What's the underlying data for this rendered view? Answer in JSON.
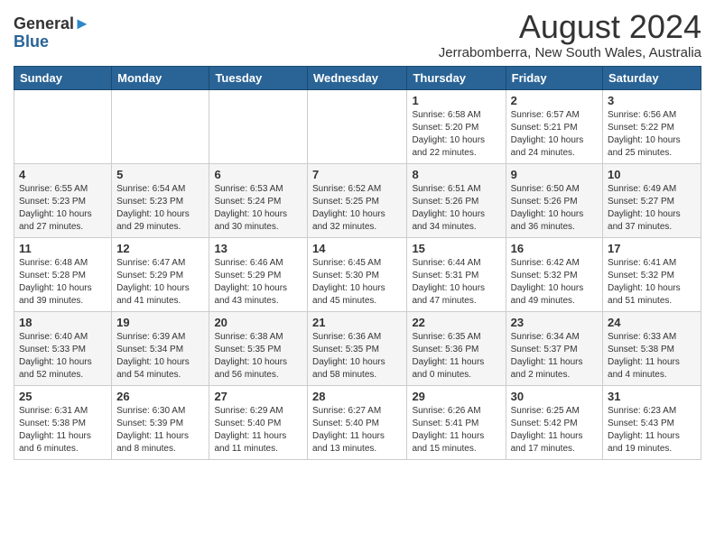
{
  "header": {
    "logo_general": "General",
    "logo_blue": "Blue",
    "month_year": "August 2024",
    "location": "Jerrabomberra, New South Wales, Australia"
  },
  "calendar": {
    "headers": [
      "Sunday",
      "Monday",
      "Tuesday",
      "Wednesday",
      "Thursday",
      "Friday",
      "Saturday"
    ],
    "weeks": [
      [
        {
          "day": "",
          "info": ""
        },
        {
          "day": "",
          "info": ""
        },
        {
          "day": "",
          "info": ""
        },
        {
          "day": "",
          "info": ""
        },
        {
          "day": "1",
          "info": "Sunrise: 6:58 AM\nSunset: 5:20 PM\nDaylight: 10 hours\nand 22 minutes."
        },
        {
          "day": "2",
          "info": "Sunrise: 6:57 AM\nSunset: 5:21 PM\nDaylight: 10 hours\nand 24 minutes."
        },
        {
          "day": "3",
          "info": "Sunrise: 6:56 AM\nSunset: 5:22 PM\nDaylight: 10 hours\nand 25 minutes."
        }
      ],
      [
        {
          "day": "4",
          "info": "Sunrise: 6:55 AM\nSunset: 5:23 PM\nDaylight: 10 hours\nand 27 minutes."
        },
        {
          "day": "5",
          "info": "Sunrise: 6:54 AM\nSunset: 5:23 PM\nDaylight: 10 hours\nand 29 minutes."
        },
        {
          "day": "6",
          "info": "Sunrise: 6:53 AM\nSunset: 5:24 PM\nDaylight: 10 hours\nand 30 minutes."
        },
        {
          "day": "7",
          "info": "Sunrise: 6:52 AM\nSunset: 5:25 PM\nDaylight: 10 hours\nand 32 minutes."
        },
        {
          "day": "8",
          "info": "Sunrise: 6:51 AM\nSunset: 5:26 PM\nDaylight: 10 hours\nand 34 minutes."
        },
        {
          "day": "9",
          "info": "Sunrise: 6:50 AM\nSunset: 5:26 PM\nDaylight: 10 hours\nand 36 minutes."
        },
        {
          "day": "10",
          "info": "Sunrise: 6:49 AM\nSunset: 5:27 PM\nDaylight: 10 hours\nand 37 minutes."
        }
      ],
      [
        {
          "day": "11",
          "info": "Sunrise: 6:48 AM\nSunset: 5:28 PM\nDaylight: 10 hours\nand 39 minutes."
        },
        {
          "day": "12",
          "info": "Sunrise: 6:47 AM\nSunset: 5:29 PM\nDaylight: 10 hours\nand 41 minutes."
        },
        {
          "day": "13",
          "info": "Sunrise: 6:46 AM\nSunset: 5:29 PM\nDaylight: 10 hours\nand 43 minutes."
        },
        {
          "day": "14",
          "info": "Sunrise: 6:45 AM\nSunset: 5:30 PM\nDaylight: 10 hours\nand 45 minutes."
        },
        {
          "day": "15",
          "info": "Sunrise: 6:44 AM\nSunset: 5:31 PM\nDaylight: 10 hours\nand 47 minutes."
        },
        {
          "day": "16",
          "info": "Sunrise: 6:42 AM\nSunset: 5:32 PM\nDaylight: 10 hours\nand 49 minutes."
        },
        {
          "day": "17",
          "info": "Sunrise: 6:41 AM\nSunset: 5:32 PM\nDaylight: 10 hours\nand 51 minutes."
        }
      ],
      [
        {
          "day": "18",
          "info": "Sunrise: 6:40 AM\nSunset: 5:33 PM\nDaylight: 10 hours\nand 52 minutes."
        },
        {
          "day": "19",
          "info": "Sunrise: 6:39 AM\nSunset: 5:34 PM\nDaylight: 10 hours\nand 54 minutes."
        },
        {
          "day": "20",
          "info": "Sunrise: 6:38 AM\nSunset: 5:35 PM\nDaylight: 10 hours\nand 56 minutes."
        },
        {
          "day": "21",
          "info": "Sunrise: 6:36 AM\nSunset: 5:35 PM\nDaylight: 10 hours\nand 58 minutes."
        },
        {
          "day": "22",
          "info": "Sunrise: 6:35 AM\nSunset: 5:36 PM\nDaylight: 11 hours\nand 0 minutes."
        },
        {
          "day": "23",
          "info": "Sunrise: 6:34 AM\nSunset: 5:37 PM\nDaylight: 11 hours\nand 2 minutes."
        },
        {
          "day": "24",
          "info": "Sunrise: 6:33 AM\nSunset: 5:38 PM\nDaylight: 11 hours\nand 4 minutes."
        }
      ],
      [
        {
          "day": "25",
          "info": "Sunrise: 6:31 AM\nSunset: 5:38 PM\nDaylight: 11 hours\nand 6 minutes."
        },
        {
          "day": "26",
          "info": "Sunrise: 6:30 AM\nSunset: 5:39 PM\nDaylight: 11 hours\nand 8 minutes."
        },
        {
          "day": "27",
          "info": "Sunrise: 6:29 AM\nSunset: 5:40 PM\nDaylight: 11 hours\nand 11 minutes."
        },
        {
          "day": "28",
          "info": "Sunrise: 6:27 AM\nSunset: 5:40 PM\nDaylight: 11 hours\nand 13 minutes."
        },
        {
          "day": "29",
          "info": "Sunrise: 6:26 AM\nSunset: 5:41 PM\nDaylight: 11 hours\nand 15 minutes."
        },
        {
          "day": "30",
          "info": "Sunrise: 6:25 AM\nSunset: 5:42 PM\nDaylight: 11 hours\nand 17 minutes."
        },
        {
          "day": "31",
          "info": "Sunrise: 6:23 AM\nSunset: 5:43 PM\nDaylight: 11 hours\nand 19 minutes."
        }
      ]
    ]
  }
}
